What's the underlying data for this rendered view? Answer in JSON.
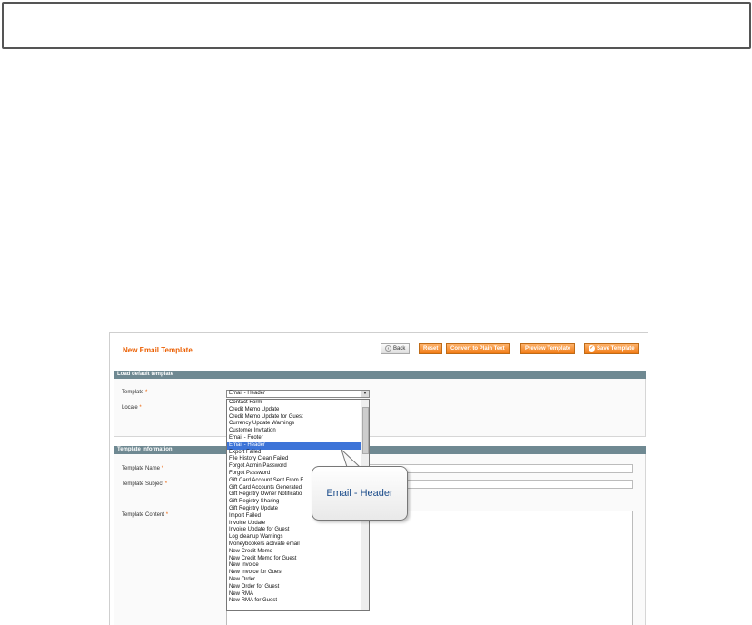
{
  "page": {
    "title": "New Email Template"
  },
  "toolbar": {
    "back": "Back",
    "reset": "Reset",
    "convert": "Convert to Plain Text",
    "preview": "Preview Template",
    "save": "Save Template"
  },
  "load_default": {
    "section_title": "Load default template",
    "template_label": "Template",
    "locale_label": "Locale",
    "selected": "Email - Header",
    "options": [
      "Contact Form",
      "Credit Memo Update",
      "Credit Memo Update for Guest",
      "Currency Update Warnings",
      "Customer Invitation",
      "Email - Footer",
      "Email - Header",
      "Export Failed",
      "File History Clean Failed",
      "Forgot Admin Password",
      "Forgot Password",
      "Gift Card Account Sent From E",
      "Gift Card Accounts Generated",
      "Gift Registry Owner Notificatio",
      "Gift Registry Sharing",
      "Gift Registry Update",
      "Import Failed",
      "Invoice Update",
      "Invoice Update for Guest",
      "Log cleanup Warnings",
      "Moneybookers activate email",
      "New Credit Memo",
      "New Credit Memo for Guest",
      "New Invoice",
      "New Invoice for Guest",
      "New Order",
      "New Order for Guest",
      "New RMA",
      "New RMA for Guest"
    ],
    "highlighted_index": 6
  },
  "template_info": {
    "section_title": "Template Information",
    "name_label": "Template Name",
    "subject_label": "Template Subject",
    "content_label": "Template Content"
  },
  "callout_text": "Email - Header",
  "required_marker": "*",
  "colors": {
    "accent": "#eb5e00",
    "section_bar": "#6f8992",
    "highlight": "#3d74d8"
  }
}
